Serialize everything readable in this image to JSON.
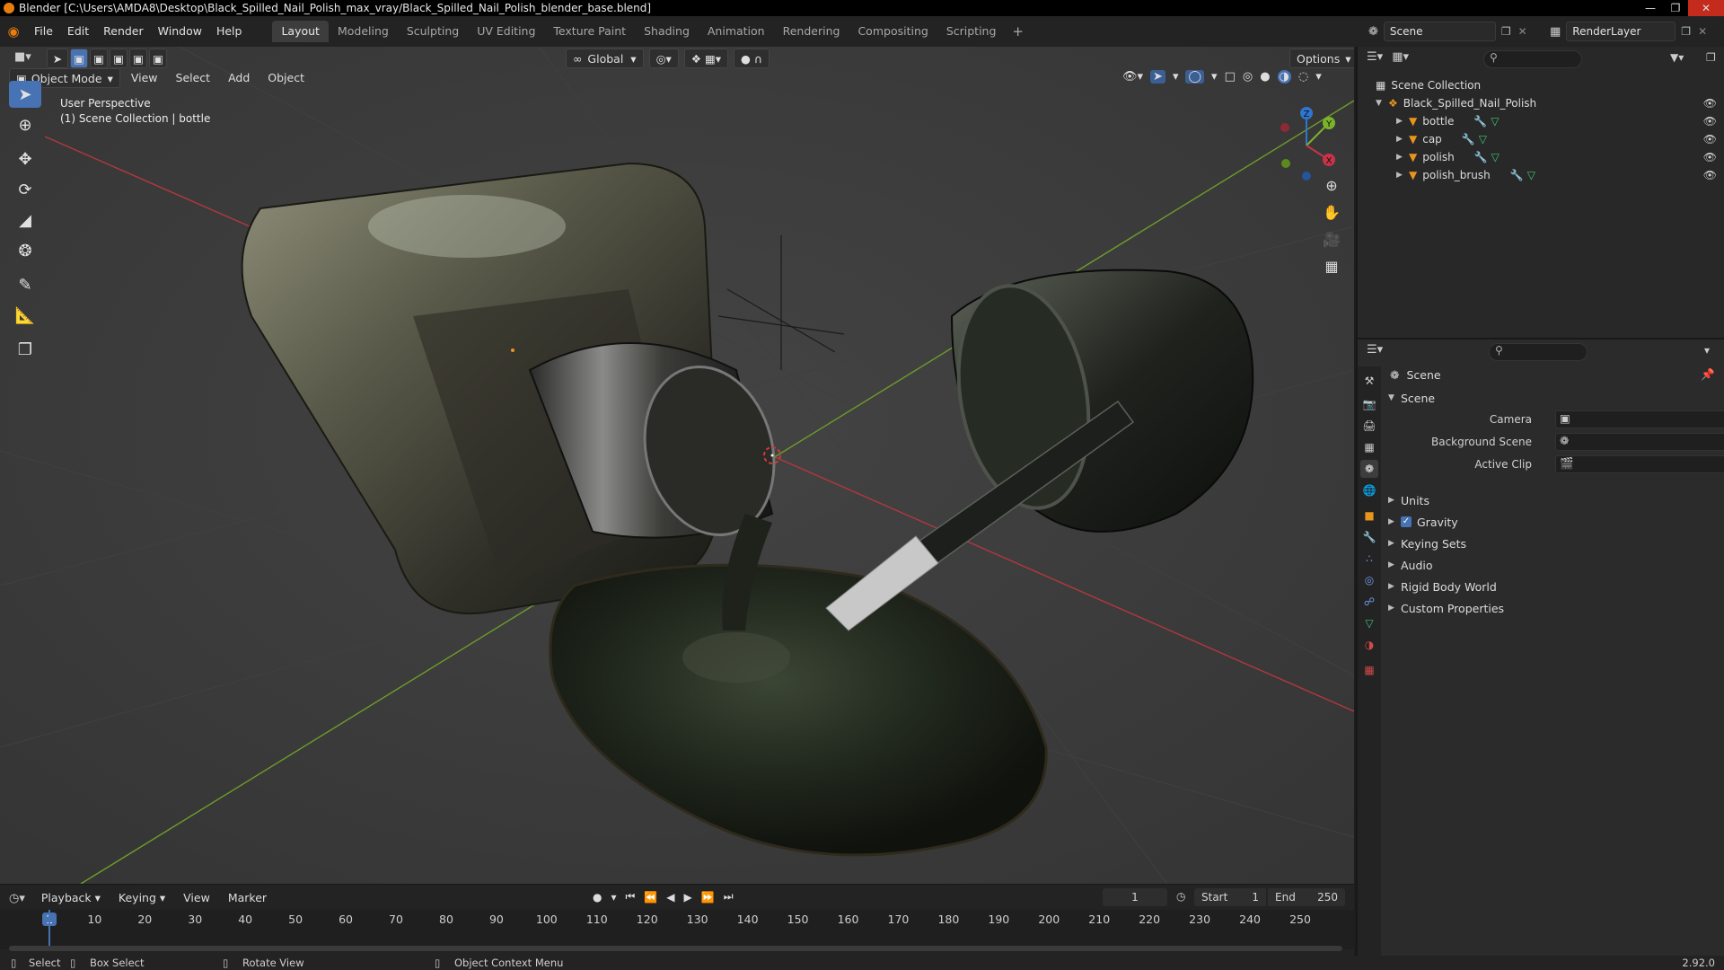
{
  "window": {
    "title": "Blender [C:\\Users\\AMDA8\\Desktop\\Black_Spilled_Nail_Polish_max_vray/Black_Spilled_Nail_Polish_blender_base.blend]"
  },
  "menu": [
    "File",
    "Edit",
    "Render",
    "Window",
    "Help"
  ],
  "workspaces": [
    "Layout",
    "Modeling",
    "Sculpting",
    "UV Editing",
    "Texture Paint",
    "Shading",
    "Animation",
    "Rendering",
    "Compositing",
    "Scripting"
  ],
  "active_workspace": "Layout",
  "top_right": {
    "scene": "Scene",
    "view_layer": "RenderLayer"
  },
  "viewport": {
    "mode": "Object Mode",
    "menus": [
      "View",
      "Select",
      "Add",
      "Object"
    ],
    "transform_orientation": "Global",
    "options_label": "Options",
    "info_line1": "User Perspective",
    "info_line2": "(1) Scene Collection | bottle",
    "gizmo_axes": {
      "z": "Z",
      "y": "Y",
      "x": "X"
    }
  },
  "outliner": {
    "root": "Scene Collection",
    "collection": "Black_Spilled_Nail_Polish",
    "objects": [
      "bottle",
      "cap",
      "polish",
      "polish_brush"
    ]
  },
  "properties": {
    "context": "Scene",
    "panel_title": "Scene",
    "fields": [
      {
        "label": "Camera"
      },
      {
        "label": "Background Scene"
      },
      {
        "label": "Active Clip"
      }
    ],
    "panels": [
      {
        "label": "Units",
        "checkbox": false
      },
      {
        "label": "Gravity",
        "checkbox": true
      },
      {
        "label": "Keying Sets",
        "checkbox": false
      },
      {
        "label": "Audio",
        "checkbox": false
      },
      {
        "label": "Rigid Body World",
        "checkbox": false
      },
      {
        "label": "Custom Properties",
        "checkbox": false
      }
    ]
  },
  "timeline": {
    "menus": [
      "Playback",
      "Keying",
      "View",
      "Marker"
    ],
    "current_frame": "1",
    "start_label": "Start",
    "start": "1",
    "end_label": "End",
    "end": "250",
    "ticks": [
      "1",
      "10",
      "20",
      "30",
      "40",
      "50",
      "60",
      "70",
      "80",
      "90",
      "100",
      "110",
      "120",
      "130",
      "140",
      "150",
      "160",
      "170",
      "180",
      "190",
      "200",
      "210",
      "220",
      "230",
      "240",
      "250"
    ]
  },
  "statusbar": {
    "select": "Select",
    "box_select": "Box Select",
    "rotate_view": "Rotate View",
    "context_menu": "Object Context Menu",
    "version": "2.92.0"
  },
  "colors": {
    "accent": "#4772b3",
    "x_axis": "#c8334a",
    "y_axis": "#7bb22a",
    "z_axis": "#2f76d1",
    "object_orange": "#e8951e",
    "mesh_green": "#3ec47a",
    "modifier_blue": "#6d9ee8"
  }
}
